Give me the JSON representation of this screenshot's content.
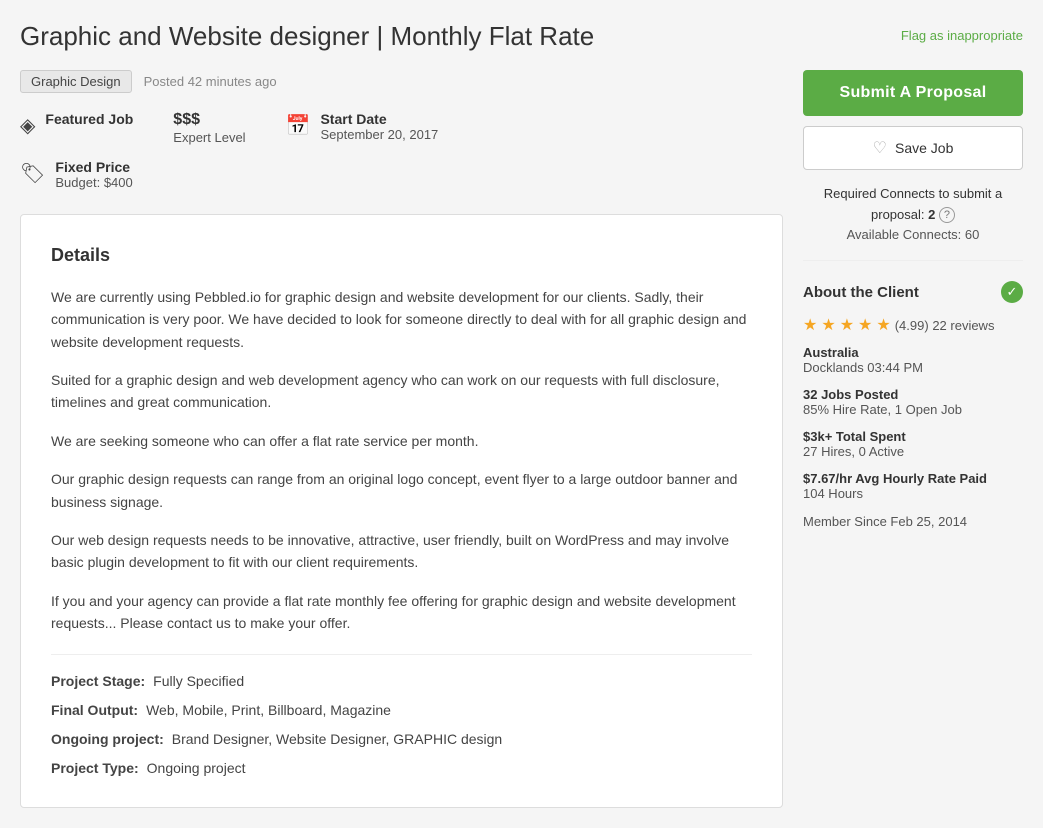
{
  "header": {
    "title": "Graphic and Website designer | Monthly Flat Rate",
    "flag_label": "Flag as inappropriate"
  },
  "meta": {
    "tag": "Graphic Design",
    "posted": "Posted 42 minutes ago"
  },
  "job_info": {
    "featured_label": "Featured Job",
    "budget_label": "Fixed Price",
    "budget_value": "Budget: $400",
    "dollar_signs": "$$$",
    "level_label": "Expert Level",
    "start_date_label": "Start Date",
    "start_date_value": "September 20, 2017"
  },
  "details": {
    "title": "Details",
    "paragraphs": [
      "We are currently using Pebbled.io for graphic design and website development for our clients.  Sadly, their communication is very poor.  We have decided to look for someone directly to deal with for all graphic design and website development requests.",
      "Suited for a graphic design and web development agency who can work on our requests with full disclosure, timelines and great communication.",
      "We are seeking someone who can offer a flat rate service per month.",
      "Our graphic design requests can range from an original logo concept, event flyer to a large outdoor banner and business signage.",
      "Our web design requests needs to be innovative, attractive, user friendly, built on WordPress and may involve basic plugin development to fit with our client requirements.",
      "If you and your agency can provide a flat rate monthly fee offering for graphic design and website development requests... Please contact us to make your offer."
    ],
    "project_stage_label": "Project Stage:",
    "project_stage_value": "Fully Specified",
    "final_output_label": "Final Output:",
    "final_output_value": "Web, Mobile, Print, Billboard, Magazine",
    "ongoing_project_label": "Ongoing project:",
    "ongoing_project_value": "Brand Designer, Website Designer, GRAPHIC design",
    "project_type_label": "Project Type:",
    "project_type_value": "Ongoing project"
  },
  "sidebar": {
    "submit_label": "Submit A Proposal",
    "save_label": "Save Job",
    "connects_text": "Required Connects to submit a proposal:",
    "connects_value": "2",
    "available_connects_text": "Available Connects: 60",
    "about_client_title": "About the Client",
    "rating": "(4.99)",
    "review_count": "22 reviews",
    "location": "Australia",
    "location_sub": "Docklands 03:44 PM",
    "jobs_posted_label": "32 Jobs Posted",
    "jobs_posted_sub": "85% Hire Rate, 1 Open Job",
    "total_spent_label": "$3k+ Total Spent",
    "total_spent_sub": "27 Hires, 0 Active",
    "avg_rate_label": "$7.67/hr Avg Hourly Rate Paid",
    "avg_rate_sub": "104 Hours",
    "member_since": "Member Since Feb 25, 2014"
  }
}
